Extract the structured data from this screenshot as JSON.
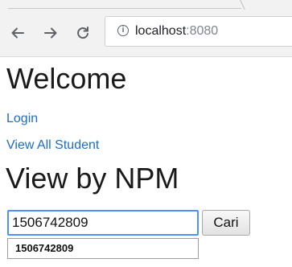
{
  "browser": {
    "url_host": "localhost",
    "url_port": ":8080",
    "info_glyph": "i",
    "icons": {
      "back": "arrow-left-icon",
      "forward": "arrow-right-icon",
      "reload": "reload-icon",
      "site_info": "info-icon"
    }
  },
  "page": {
    "heading": "Welcome",
    "links": {
      "login": "Login",
      "view_all": "View All Student"
    },
    "search_heading": "View by NPM",
    "npm_input_value": "1506742809",
    "submit_label": "Cari",
    "suggestions": [
      "1506742809"
    ]
  },
  "colors": {
    "link": "#1a6fc4",
    "focus_ring": "#4d90fe",
    "toolbar_bg": "#f2f2f2"
  }
}
